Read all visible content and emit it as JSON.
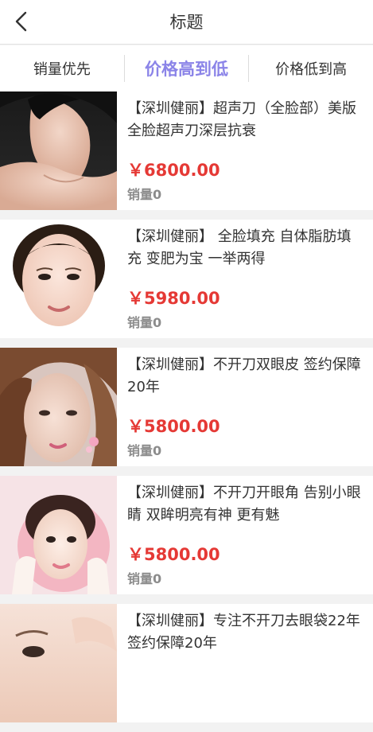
{
  "header": {
    "title": "标题",
    "back_icon": "chevron-left-icon"
  },
  "tabs": [
    {
      "label": "销量优先",
      "active": false
    },
    {
      "label": "价格高到低",
      "active": true
    },
    {
      "label": "价格低到高",
      "active": false
    }
  ],
  "colors": {
    "active_tab": "#8b84e8",
    "price": "#e53935",
    "sales": "#8c8c8c"
  },
  "products": [
    {
      "name": "【深圳健丽】超声刀（全脸部）美版全脸超声刀深层抗衰",
      "price": "￥6800.00",
      "sales": "销量0"
    },
    {
      "name": "【深圳健丽】 全脸填充 自体脂肪填充 变肥为宝 一举两得",
      "price": "￥5980.00",
      "sales": "销量0"
    },
    {
      "name": "【深圳健丽】不开刀双眼皮 签约保障20年",
      "price": "￥5800.00",
      "sales": "销量0"
    },
    {
      "name": "【深圳健丽】不开刀开眼角 告别小眼睛 双眸明亮有神 更有魅",
      "price": "￥5800.00",
      "sales": "销量0"
    },
    {
      "name": "【深圳健丽】专注不开刀去眼袋22年 签约保障20年",
      "price": "",
      "sales": ""
    }
  ]
}
